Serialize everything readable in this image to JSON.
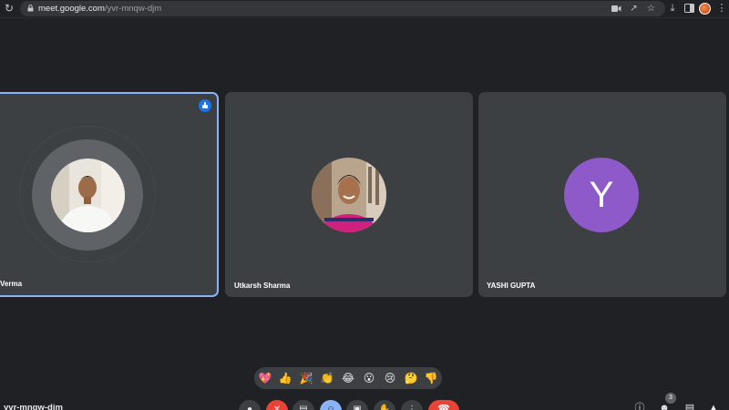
{
  "browser": {
    "url_domain": "meet.google.com",
    "url_path": "/yvr-mnqw-djm"
  },
  "participants": [
    {
      "name": "Verma",
      "avatar": "photo",
      "speaking": true
    },
    {
      "name": "Utkarsh Sharma",
      "avatar": "photo",
      "speaking": false
    },
    {
      "name": "YASHI GUPTA",
      "avatar_letter": "Y",
      "avatar_color": "#8e59c9",
      "speaking": false
    }
  ],
  "reactions": [
    "💖",
    "👍",
    "🎉",
    "👏",
    "😂",
    "😮",
    "😢",
    "🤔",
    "👎"
  ],
  "meeting": {
    "code": "yvr-mnqw-djm",
    "participant_count": "3"
  },
  "colors": {
    "background": "#202124",
    "tile": "#3c4043",
    "active_border": "#8ab4f8",
    "end_call": "#ea4335"
  }
}
